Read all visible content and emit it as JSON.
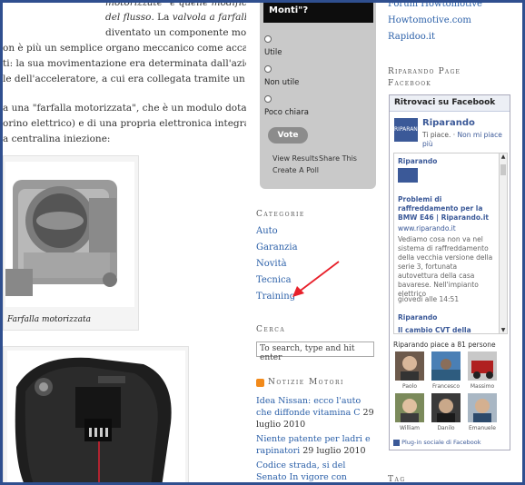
{
  "article": {
    "line1a": "motorizzate\" e quelle modificheranno",
    "line2a": "del flusso",
    "line2b": ". La ",
    "line2c": "valvola a farfalla",
    "line2d": " è",
    "line3": "diventato un componente molto",
    "line4": "on è più un semplice organo meccanico come accadeva nei",
    "line5": "ti: la sua movimentazione era determinata dall'azione del",
    "line6": "le dell'acceleratore, a cui era collegata tramite un cavo in",
    "line7": "a una \"farfalla motorizzata\", che è un modulo dotato di un",
    "line8": "orino elettrico) e di una propria elettronica integrata,",
    "line9": "a centralina iniezione:",
    "caption1": "Farfalla motorizzata"
  },
  "poll": {
    "question": "Monti\"?",
    "options": [
      "Utile",
      "Non utile",
      "Poco chiara"
    ],
    "vote_label": "Vote",
    "view_results": "View Results",
    "share": "Share This",
    "create": "Create A Poll"
  },
  "categories": {
    "title": "Categorie",
    "items": [
      "Auto",
      "Garanzia",
      "Novità",
      "Tecnica",
      "Training"
    ]
  },
  "search": {
    "title": "Cerca",
    "placeholder": "To search, type and hit enter"
  },
  "news": {
    "title": "Notizie Motori",
    "items": [
      {
        "text": "Idea Nissan: ecco l'auto che diffonde vitamina C",
        "date": "29 luglio 2010"
      },
      {
        "text": "Niente patente per ladri e rapinatori",
        "date": "29 luglio 2010"
      },
      {
        "text": "Codice strada, si del Senato In vigore con l'esodo di venerdì",
        "date": ""
      }
    ]
  },
  "right": {
    "link1": "Forum Howtomotive",
    "link2": "Howtomotive.com",
    "link3": "Rapidoo.it",
    "fb_section_title": "Riparando Page Facebook",
    "tag_title": "Tag"
  },
  "facebook": {
    "header": "Ritrovaci su Facebook",
    "logo_text": "RIPARANDO",
    "page_name": "Riparando",
    "like_text": "Ti piace. ·",
    "unlike_text": "Non mi piace più",
    "post1_author": "Riparando",
    "post1_title": "Problemi di raffreddamento per la BMW E46 | Riparando.it",
    "post1_url": "www.riparando.it",
    "post1_body": "Vediamo cosa non va nel sistema di raffreddamento della vecchia versione della serie 3, fortunata autovettura della casa bavarese. Nell'impianto elettrico",
    "post1_date": "giovedì alle 14:51",
    "post2_author": "Riparando",
    "post2_title": "Il cambio CVT della",
    "likes_count": "Riparando piace a 81 persone",
    "faces": [
      "Paolo",
      "Francesco",
      "Massimo",
      "William",
      "Danilo",
      "Emanuele"
    ],
    "plugin": "Plug-in sociale di Facebook"
  },
  "colors": {
    "link": "#2a5fa8",
    "fb_blue": "#3b5998",
    "frame": "#2f4f8f",
    "arrow": "#e8202a"
  }
}
